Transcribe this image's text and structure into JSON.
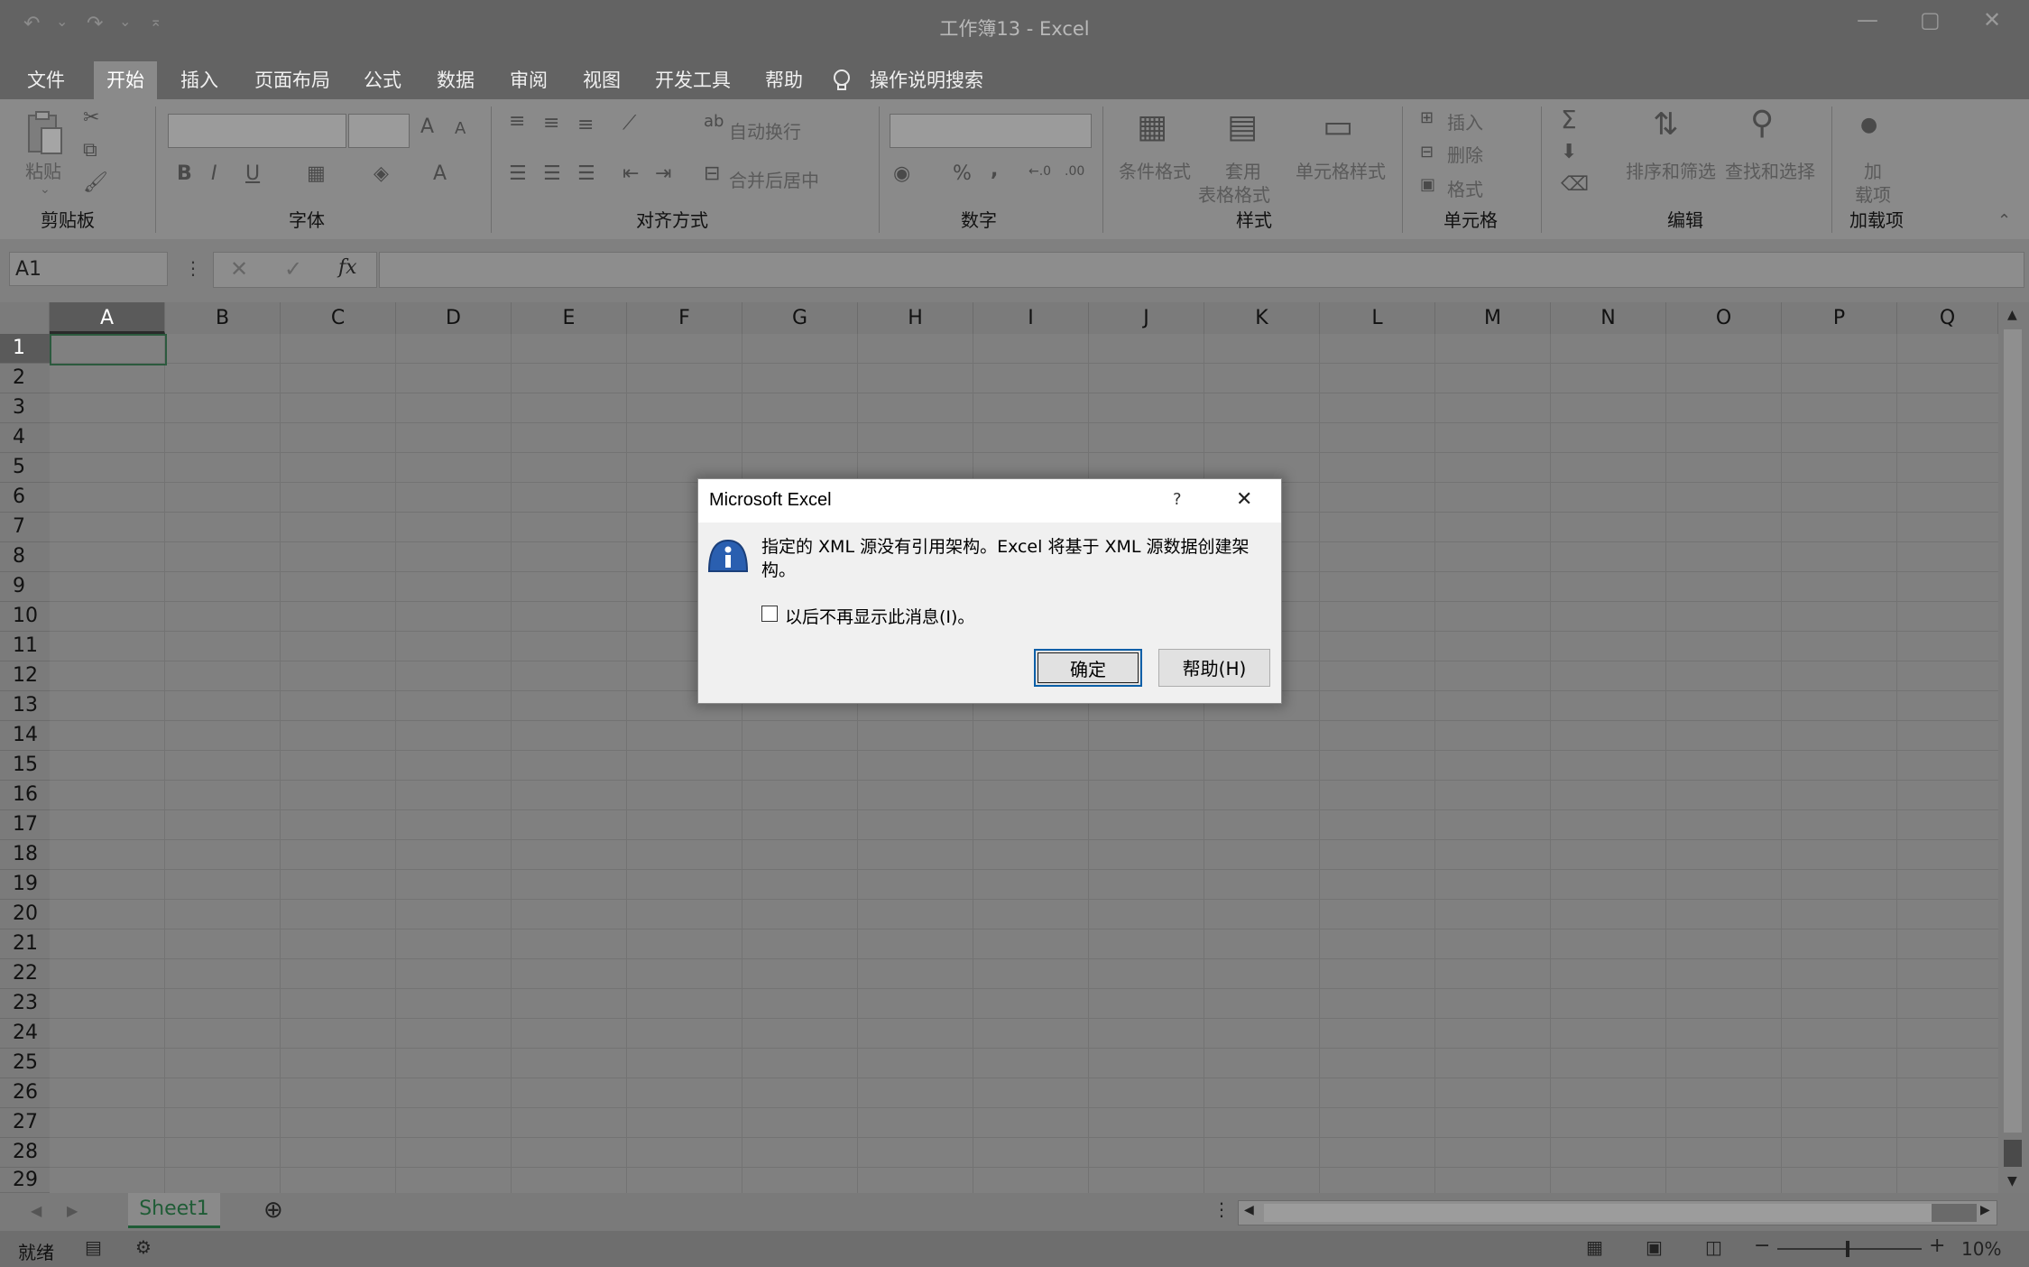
{
  "window": {
    "title": "工作簿13  -  Excel",
    "quick_access": {
      "undo": "↶",
      "undo_drop": "⌄",
      "redo": "↷",
      "redo_drop": "⌄",
      "customize": "⚲"
    },
    "controls": {
      "minimize": "—",
      "restore": "▢",
      "close": "✕"
    }
  },
  "menu": [
    "文件",
    "开始",
    "插入",
    "页面布局",
    "公式",
    "数据",
    "审阅",
    "视图",
    "开发工具",
    "帮助"
  ],
  "menu_search": "操作说明搜索",
  "ribbon": {
    "clipboard": {
      "paste": "粘贴",
      "group": "剪贴板"
    },
    "font": {
      "group": "字体",
      "bold": "B",
      "italic": "I",
      "underline": "U",
      "grow": "A",
      "shrink": "A"
    },
    "alignment": {
      "wrap": "自动换行",
      "merge": "合并后居中",
      "group": "对齐方式"
    },
    "number": {
      "group": "数字",
      "percent": "%",
      "comma": ","
    },
    "styles": {
      "conditional": "条件格式",
      "table_l1": "套用",
      "table_l2": "表格格式",
      "cell_styles": "单元格样式",
      "group": "样式"
    },
    "cells": {
      "insert": "插入",
      "delete": "删除",
      "format": "格式",
      "group": "单元格"
    },
    "editing": {
      "sum": "Σ",
      "sort": "排序和筛选",
      "find": "查找和选择",
      "group": "编辑"
    },
    "addins": {
      "l1": "加",
      "l2": "载项",
      "group": "加载项"
    }
  },
  "formula_bar": {
    "name_box": "A1",
    "fx": "fx",
    "value": ""
  },
  "columns": [
    "A",
    "B",
    "C",
    "D",
    "E",
    "F",
    "G",
    "H",
    "I",
    "J",
    "K",
    "L",
    "M",
    "N",
    "O",
    "P",
    "Q"
  ],
  "rows": [
    "1",
    "2",
    "3",
    "4",
    "5",
    "6",
    "7",
    "8",
    "9",
    "10",
    "11",
    "12",
    "13",
    "14",
    "15",
    "16",
    "17",
    "18",
    "19",
    "20",
    "21",
    "22",
    "23",
    "24",
    "25",
    "26",
    "27",
    "28",
    "29"
  ],
  "sheet_tabs": [
    "Sheet1"
  ],
  "status": {
    "ready": "就绪",
    "zoom": "10%"
  },
  "dialog": {
    "title": "Microsoft Excel",
    "help_q": "?",
    "close": "✕",
    "message_line1": "指定的 XML 源没有引用架构。Excel 将基于 XML 源数据创建架",
    "message_line2": "构。",
    "checkbox_label": "以后不再显示此消息(I)。",
    "ok": "确定",
    "help": "帮助(H)"
  }
}
